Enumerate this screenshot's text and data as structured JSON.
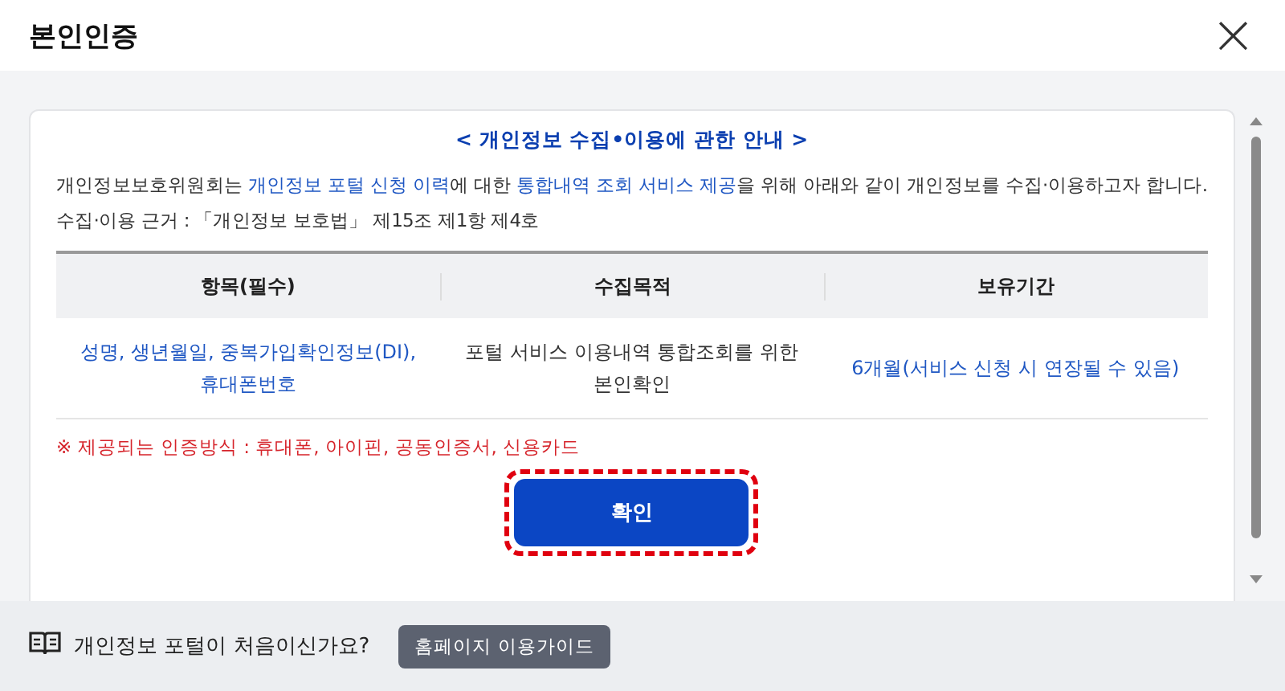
{
  "dialog": {
    "title": "본인인증",
    "close": "×"
  },
  "notice": {
    "heading": "< 개인정보 수집•이용에 관한 안내 >",
    "intro": [
      {
        "text": "개인정보보호위원회는 ",
        "highlight": false
      },
      {
        "text": "개인정보 포털 신청 이력",
        "highlight": true
      },
      {
        "text": "에 대한 ",
        "highlight": false
      },
      {
        "text": "통합내역 조회 서비스 제공",
        "highlight": true
      },
      {
        "text": "을 위해 아래와 같이 개인정보를 수집·이용하고자 합니다.",
        "highlight": false
      }
    ],
    "basis": "수집·이용 근거 : 「개인정보 보호법」 제15조 제1항 제4호",
    "table": {
      "columns": [
        "항목(필수)",
        "수집목적",
        "보유기간"
      ],
      "rows": [
        [
          {
            "text": "성명, 생년월일, 중복가입확인정보(DI), 휴대폰번호",
            "highlight": true
          },
          {
            "text": "포털 서비스 이용내역 통합조회를 위한 본인확인",
            "highlight": false
          },
          {
            "text": "6개월(서비스 신청 시 연장될 수 있음)",
            "highlight": true
          }
        ]
      ]
    },
    "methods": "※ 제공되는 인증방식 : 휴대폰, 아이핀, 공동인증서, 신용카드",
    "confirm": {
      "label": "확인",
      "highlighted": true
    }
  },
  "footer": {
    "question": "개인정보 포털이 처음이신가요?",
    "guide_button": "홈페이지 이용가이드"
  }
}
